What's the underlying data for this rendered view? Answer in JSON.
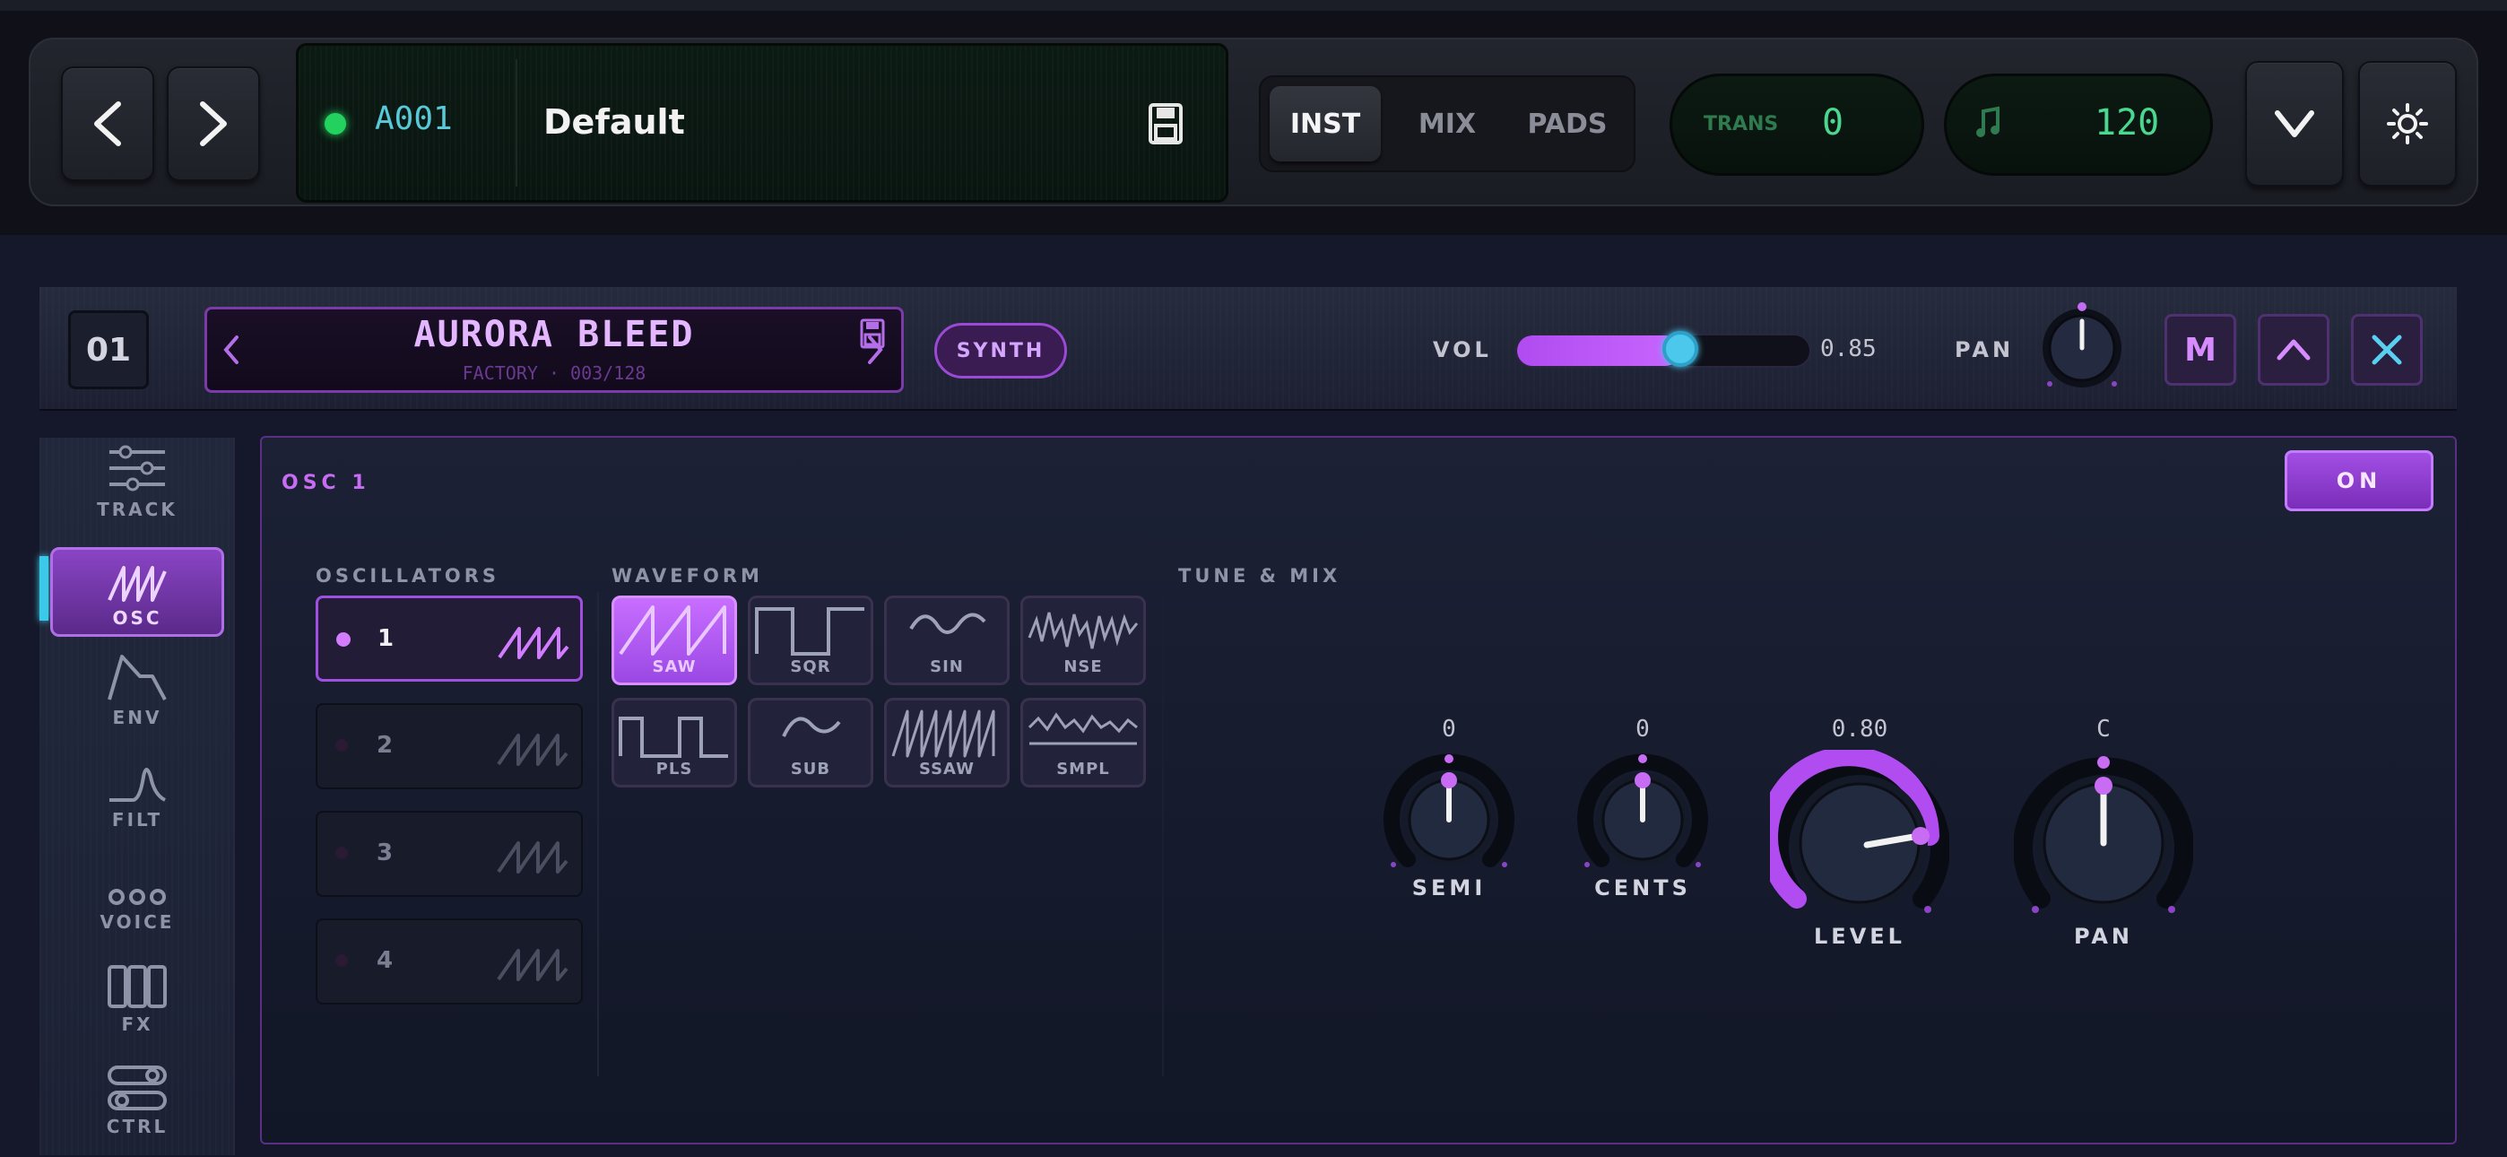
{
  "top": {
    "prev_icon": "chevron-left-icon",
    "next_icon": "chevron-right-icon",
    "lcd": {
      "code": "A001",
      "name": "Default",
      "save_icon": "save-icon",
      "status_color": "#22d15e"
    },
    "tabs": [
      {
        "label": "INST",
        "active": true
      },
      {
        "label": "MIX",
        "active": false
      },
      {
        "label": "PADS",
        "active": false
      }
    ],
    "trans": {
      "label": "TRANS",
      "value": "0"
    },
    "tempo": {
      "icon": "music-note-icon",
      "value": "120"
    },
    "collapse_icon": "chevron-down-icon",
    "settings_icon": "gear-icon"
  },
  "track": {
    "number": "01",
    "preset_name": "AURORA BLEED",
    "preset_sub": "FACTORY · 003/128",
    "type_button": "SYNTH",
    "vol_label": "VOL",
    "vol_value": "0.85",
    "vol_level": 0.55,
    "pan_label": "PAN",
    "mute_label": "M",
    "accent_color": "#b04cf0",
    "cyan_color": "#4cc8ec"
  },
  "sidebar": {
    "items": [
      {
        "label": "TRACK",
        "icon": "sliders-icon",
        "active": false
      },
      {
        "label": "OSC",
        "icon": "oscillator-wave-icon",
        "active": true
      },
      {
        "label": "ENV",
        "icon": "envelope-icon",
        "active": false
      },
      {
        "label": "FILT",
        "icon": "filter-icon",
        "active": false
      },
      {
        "label": "VOICE",
        "icon": "voice-dots-icon",
        "active": false
      },
      {
        "label": "FX",
        "icon": "fx-icon",
        "active": false
      },
      {
        "label": "CTRL",
        "icon": "toggles-icon",
        "active": false
      }
    ]
  },
  "panel": {
    "title": "OSC 1",
    "on_label": "ON",
    "oscillators_label": "OSCILLATORS",
    "oscillators": [
      {
        "num": "1",
        "active": true
      },
      {
        "num": "2",
        "active": false
      },
      {
        "num": "3",
        "active": false
      },
      {
        "num": "4",
        "active": false
      }
    ],
    "waveform_label": "WAVEFORM",
    "waveforms": [
      {
        "label": "SAW",
        "active": true
      },
      {
        "label": "SQR",
        "active": false
      },
      {
        "label": "SIN",
        "active": false
      },
      {
        "label": "NSE",
        "active": false
      },
      {
        "label": "PLS",
        "active": false
      },
      {
        "label": "SUB",
        "active": false
      },
      {
        "label": "SSAW",
        "active": false
      },
      {
        "label": "SMPL",
        "active": false
      }
    ],
    "tune_label": "TUNE & MIX",
    "knobs": [
      {
        "label": "SEMI",
        "value": "0"
      },
      {
        "label": "CENTS",
        "value": "0"
      },
      {
        "label": "LEVEL",
        "value": "0.80"
      },
      {
        "label": "PAN",
        "value": "C"
      }
    ]
  }
}
